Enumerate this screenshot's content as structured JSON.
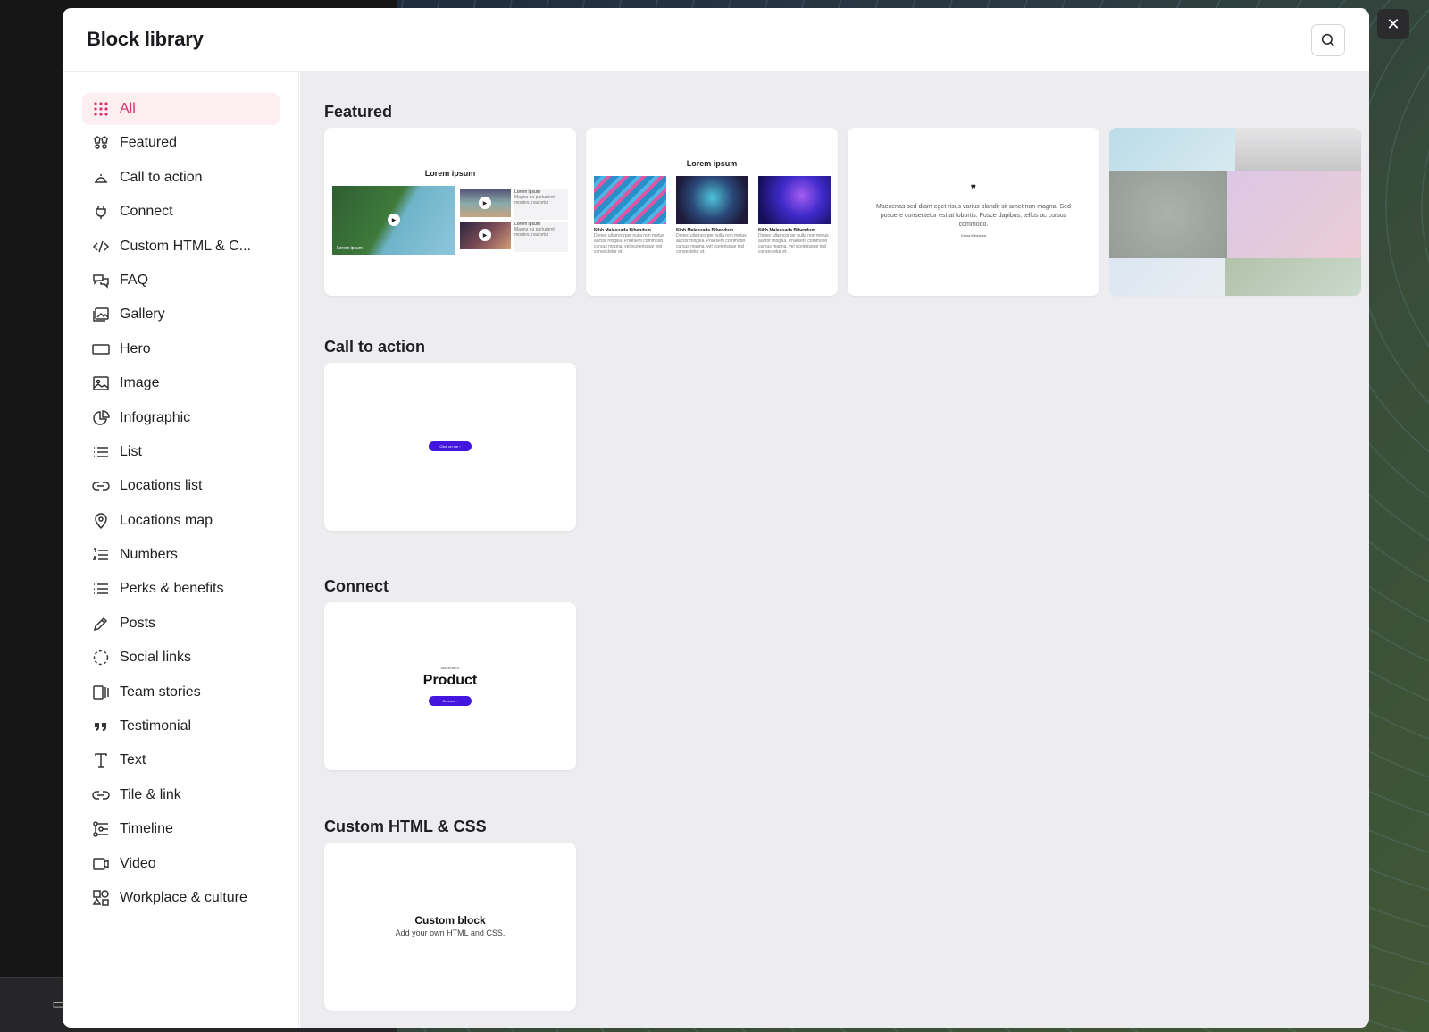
{
  "modal": {
    "title": "Block library",
    "search_icon": "search-icon",
    "close_icon": "close-icon"
  },
  "sidebar": {
    "items": [
      {
        "label": "All",
        "icon": "grid-icon",
        "active": true
      },
      {
        "label": "Featured",
        "icon": "featured-icon"
      },
      {
        "label": "Call to action",
        "icon": "bell-icon"
      },
      {
        "label": "Connect",
        "icon": "plug-icon"
      },
      {
        "label": "Custom HTML & C...",
        "icon": "code-icon"
      },
      {
        "label": "FAQ",
        "icon": "chat-icon"
      },
      {
        "label": "Gallery",
        "icon": "gallery-icon"
      },
      {
        "label": "Hero",
        "icon": "hero-icon"
      },
      {
        "label": "Image",
        "icon": "image-icon"
      },
      {
        "label": "Infographic",
        "icon": "pie-icon"
      },
      {
        "label": "List",
        "icon": "list-icon"
      },
      {
        "label": "Locations list",
        "icon": "link-icon"
      },
      {
        "label": "Locations map",
        "icon": "pin-icon"
      },
      {
        "label": "Numbers",
        "icon": "numbered-list-icon"
      },
      {
        "label": "Perks & benefits",
        "icon": "list-icon"
      },
      {
        "label": "Posts",
        "icon": "pencil-icon"
      },
      {
        "label": "Social links",
        "icon": "dashed-circle-icon"
      },
      {
        "label": "Team stories",
        "icon": "stories-icon"
      },
      {
        "label": "Testimonial",
        "icon": "quote-icon"
      },
      {
        "label": "Text",
        "icon": "text-icon"
      },
      {
        "label": "Tile & link",
        "icon": "link-icon"
      },
      {
        "label": "Timeline",
        "icon": "timeline-icon"
      },
      {
        "label": "Video",
        "icon": "video-icon"
      },
      {
        "label": "Workplace & culture",
        "icon": "shapes-icon"
      }
    ]
  },
  "sections": {
    "featured": {
      "title": "Featured"
    },
    "cta": {
      "title": "Call to action"
    },
    "connect": {
      "title": "Connect"
    },
    "custom": {
      "title": "Custom HTML & CSS"
    }
  },
  "cards": {
    "video": {
      "title": "Lorem ipsum",
      "main_caption": "Lorem ipsum",
      "main_sub": "Magna du parturient montes, nascetur",
      "item1_title": "Lorem ipsum",
      "item1_text": "Magna du parturient montes, nascetur",
      "item2_title": "Lorem ipsum",
      "item2_text": "Magna du parturient montes, nascetur"
    },
    "columns": {
      "title": "Lorem ipsum",
      "col_title": "Nibh Malesuada Bibendum",
      "col_text": "Donec ullamcorper nulla non metus auctor fringilla. Praesent commodo cursus magna, vel scelerisque nisl consectetur et."
    },
    "quote": {
      "mark": "❞",
      "text": "Maecenas sed diam eget risus varius blandit sit amet non magna. Sed posuere consectetur est at lobortis. Fusce dapibus, tellus ac cursus commodo.",
      "author": "Kiona Mendoza"
    },
    "cta": {
      "button": "Click on me ›"
    },
    "connect": {
      "eyebrow": "DEPARTMENT",
      "title": "Product",
      "button": "Connect ›"
    },
    "custom": {
      "title": "Custom block",
      "subtitle": "Add your own HTML and CSS."
    }
  },
  "colors": {
    "accent": "#d6336c",
    "active_bg": "#fdeef2",
    "button_purple": "#4316e0",
    "content_bg": "#ededf0"
  }
}
